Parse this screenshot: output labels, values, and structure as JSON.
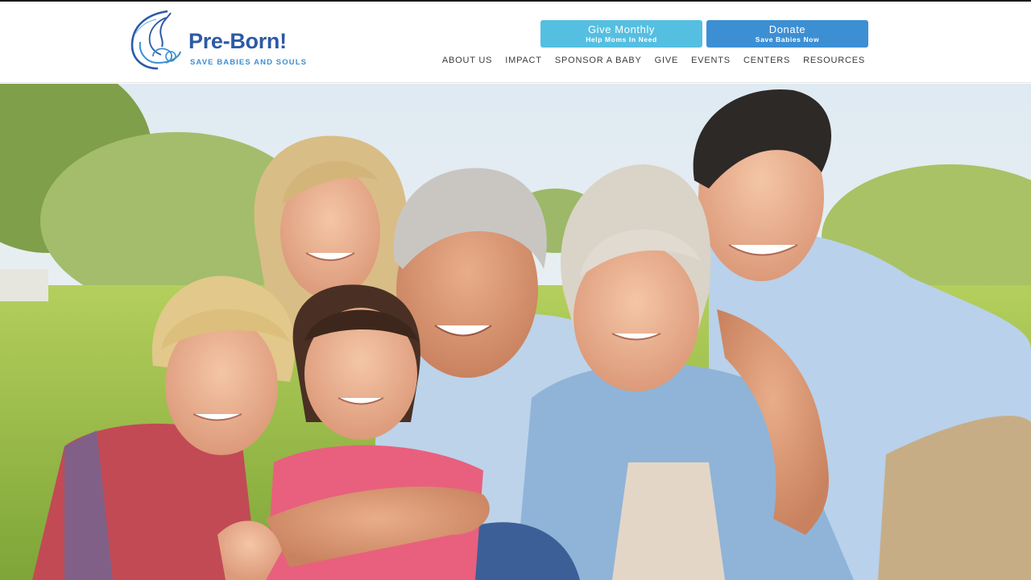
{
  "site": {
    "brand_name": "Pre-Born!",
    "brand_tagline": "SAVE BABIES AND SOULS"
  },
  "header": {
    "cta_monthly": {
      "title": "Give Monthly",
      "subtitle": "Help Moms In Need"
    },
    "cta_donate": {
      "title": "Donate",
      "subtitle": "Save Babies Now"
    },
    "nav": [
      "ABOUT US",
      "IMPACT",
      "SPONSOR A BABY",
      "GIVE",
      "EVENTS",
      "CENTERS",
      "RESOURCES"
    ]
  },
  "hero": {
    "image_alt": "Smiling multigenerational family sitting together on grass outdoors"
  },
  "colors": {
    "brand_blue": "#2c5aa6",
    "tagline_blue": "#3d8fd2",
    "cta_light": "#55bfe1",
    "cta_dark": "#3d8fd4",
    "nav_text": "#3a3a3a"
  }
}
